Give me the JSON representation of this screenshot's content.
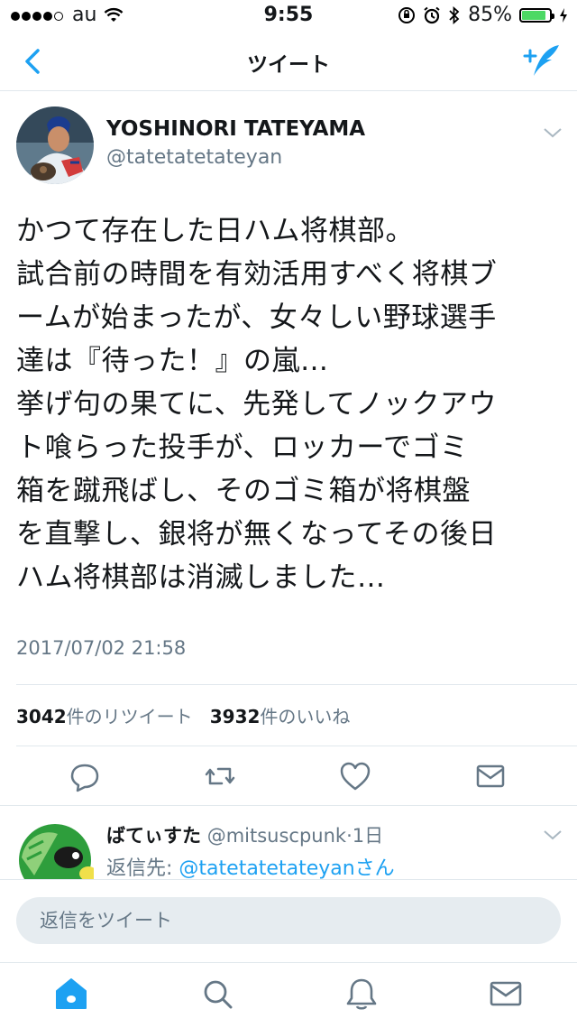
{
  "status_bar": {
    "carrier": "au",
    "time": "9:55",
    "battery": "85%",
    "battery_level": 0.85
  },
  "nav": {
    "title": "ツイート",
    "back_icon": "chevron-left-icon",
    "compose_icon": "compose-tweet-icon"
  },
  "tweet": {
    "author_name": "YOSHINORI TATEYAMA",
    "author_handle": "@tatetatetateyan",
    "lines": [
      "かつて存在した日ハム将棋部。",
      "試合前の時間を有効活用すべく将棋ブ",
      "ームが始まったが、女々しい野球選手",
      "達は『待った！』の嵐…",
      "挙げ句の果てに、先発してノックアウ",
      "ト喰らった投手が、ロッカーでゴミ",
      "箱を蹴飛ばし、そのゴミ箱が将棋盤",
      "を直撃し、銀将が無くなってその後日",
      "ハム将棋部は消滅しました…"
    ],
    "timestamp": "2017/07/02 21:58",
    "retweet_count": "3042",
    "retweet_label": "件のリツイート",
    "like_count": "3932",
    "like_label": "件のいいね",
    "actions": [
      "reply-icon",
      "retweet-icon",
      "like-icon",
      "dm-icon"
    ]
  },
  "reply": {
    "name": "ばてぃすた",
    "handle": "@mitsuscpunk",
    "time": "·1日",
    "reply_to_label": "返信先:",
    "reply_to_handle": "@tatetatetateyan",
    "reply_to_suffix": "さん"
  },
  "compose": {
    "placeholder": "返信をツイート"
  },
  "tabs": [
    "home-icon",
    "search-icon",
    "notifications-icon",
    "messages-icon"
  ],
  "colors": {
    "accent": "#1da1f2",
    "secondary_text": "#657786",
    "divider": "#e1e8ed",
    "battery": "#4cd964"
  }
}
